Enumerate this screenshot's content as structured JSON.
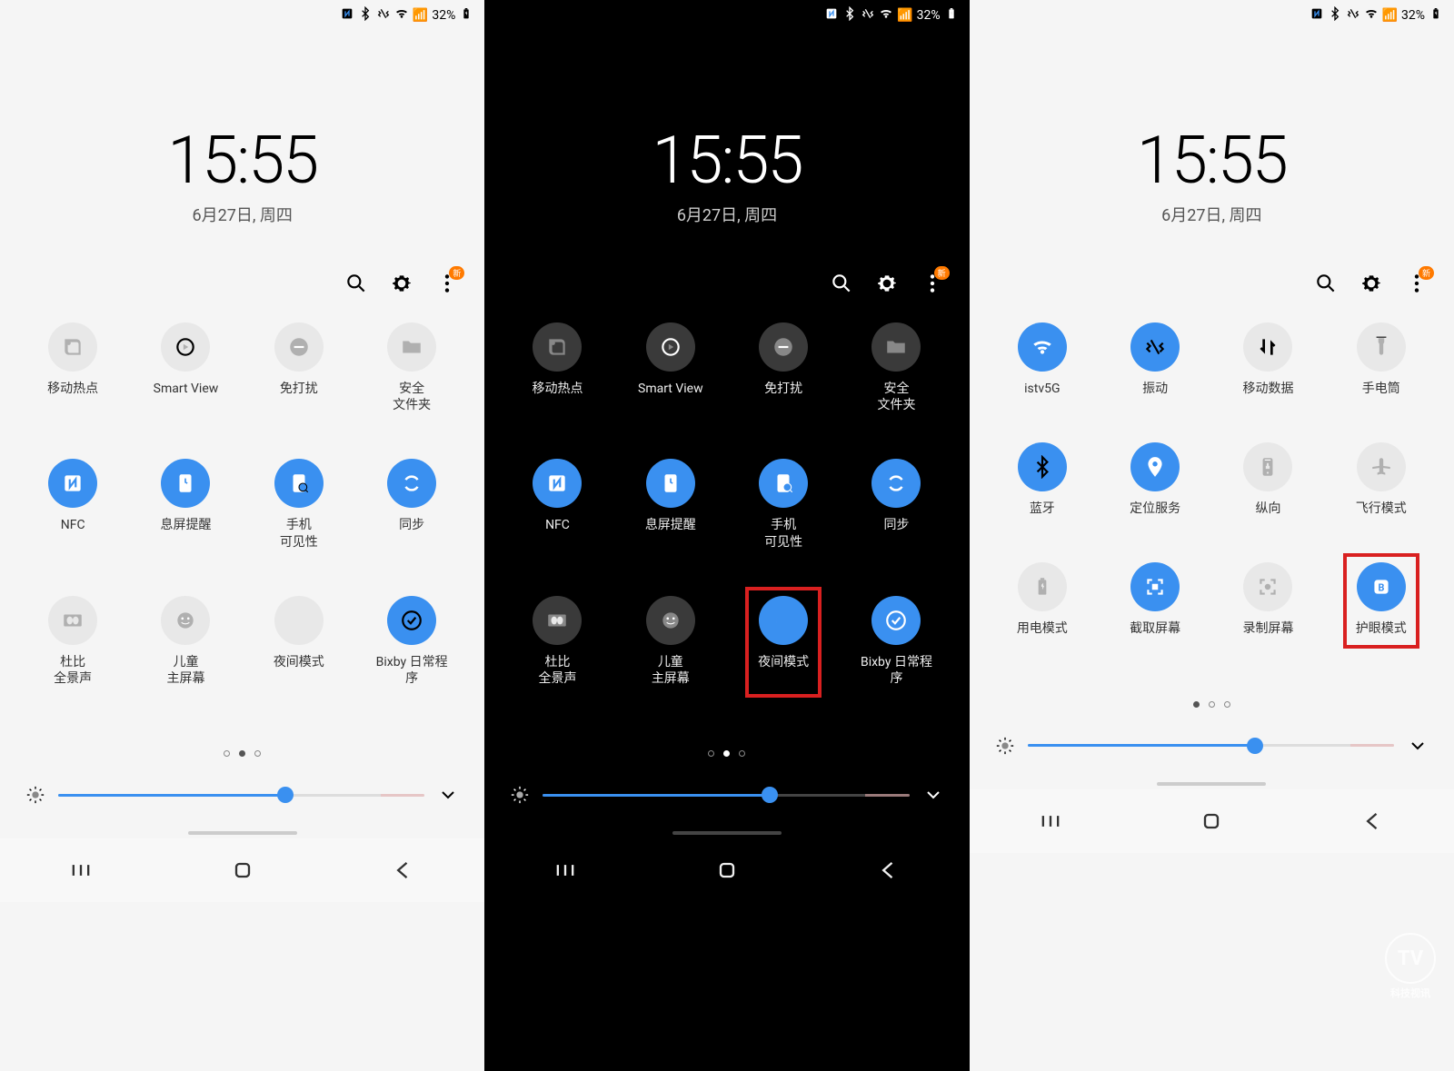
{
  "status": {
    "battery_pct": "32%"
  },
  "clock": {
    "time": "15:55",
    "date": "6月27日, 周四"
  },
  "action_badge": "新",
  "panels": [
    {
      "theme": "light",
      "tiles": [
        {
          "label": "移动热点",
          "on": false,
          "icon": "hotspot",
          "hl": false
        },
        {
          "label": "Smart View",
          "on": false,
          "icon": "smartview",
          "hl": false
        },
        {
          "label": "免打扰",
          "on": false,
          "icon": "dnd",
          "hl": false
        },
        {
          "label": "安全\n文件夹",
          "on": false,
          "icon": "folder",
          "hl": false
        },
        {
          "label": "NFC",
          "on": true,
          "icon": "nfc",
          "hl": false
        },
        {
          "label": "息屏提醒",
          "on": true,
          "icon": "aod",
          "hl": false
        },
        {
          "label": "手机\n可见性",
          "on": true,
          "icon": "visibility",
          "hl": false
        },
        {
          "label": "同步",
          "on": true,
          "icon": "sync",
          "hl": false
        },
        {
          "label": "杜比\n全景声",
          "on": false,
          "icon": "dolby",
          "hl": false
        },
        {
          "label": "儿童\n主屏幕",
          "on": false,
          "icon": "kids",
          "hl": false
        },
        {
          "label": "夜间模式",
          "on": false,
          "icon": "moon",
          "hl": false
        },
        {
          "label": "Bixby 日常程\n序",
          "on": true,
          "icon": "bixby",
          "hl": false
        }
      ],
      "active_dot": 1,
      "brightness_pct": 62
    },
    {
      "theme": "dark",
      "tiles": [
        {
          "label": "移动热点",
          "on": false,
          "icon": "hotspot",
          "hl": false
        },
        {
          "label": "Smart View",
          "on": false,
          "icon": "smartview",
          "hl": false
        },
        {
          "label": "免打扰",
          "on": false,
          "icon": "dnd",
          "hl": false
        },
        {
          "label": "安全\n文件夹",
          "on": false,
          "icon": "folder",
          "hl": false
        },
        {
          "label": "NFC",
          "on": true,
          "icon": "nfc",
          "hl": false
        },
        {
          "label": "息屏提醒",
          "on": true,
          "icon": "aod",
          "hl": false
        },
        {
          "label": "手机\n可见性",
          "on": true,
          "icon": "visibility",
          "hl": false
        },
        {
          "label": "同步",
          "on": true,
          "icon": "sync",
          "hl": false
        },
        {
          "label": "杜比\n全景声",
          "on": false,
          "icon": "dolby",
          "hl": false
        },
        {
          "label": "儿童\n主屏幕",
          "on": false,
          "icon": "kids",
          "hl": false
        },
        {
          "label": "夜间模式",
          "on": true,
          "icon": "moon",
          "hl": true
        },
        {
          "label": "Bixby 日常程\n序",
          "on": true,
          "icon": "bixby",
          "hl": false
        }
      ],
      "active_dot": 1,
      "brightness_pct": 62
    },
    {
      "theme": "light",
      "tiles": [
        {
          "label": "istv5G",
          "on": true,
          "icon": "wifi",
          "hl": false
        },
        {
          "label": "振动",
          "on": true,
          "icon": "vibrate",
          "hl": false
        },
        {
          "label": "移动数据",
          "on": false,
          "icon": "data",
          "hl": false
        },
        {
          "label": "手电筒",
          "on": false,
          "icon": "torch",
          "hl": false
        },
        {
          "label": "蓝牙",
          "on": true,
          "icon": "bluetooth",
          "hl": false
        },
        {
          "label": "定位服务",
          "on": true,
          "icon": "location",
          "hl": false
        },
        {
          "label": "纵向",
          "on": false,
          "icon": "portrait",
          "hl": false
        },
        {
          "label": "飞行模式",
          "on": false,
          "icon": "airplane",
          "hl": false
        },
        {
          "label": "用电模式",
          "on": false,
          "icon": "battery",
          "hl": false
        },
        {
          "label": "截取屏幕",
          "on": true,
          "icon": "screenshot",
          "hl": false
        },
        {
          "label": "录制屏幕",
          "on": false,
          "icon": "record",
          "hl": false
        },
        {
          "label": "护眼模式",
          "on": true,
          "icon": "eyecare",
          "hl": true
        }
      ],
      "active_dot": 0,
      "brightness_pct": 62
    }
  ],
  "watermark": "科技视讯"
}
